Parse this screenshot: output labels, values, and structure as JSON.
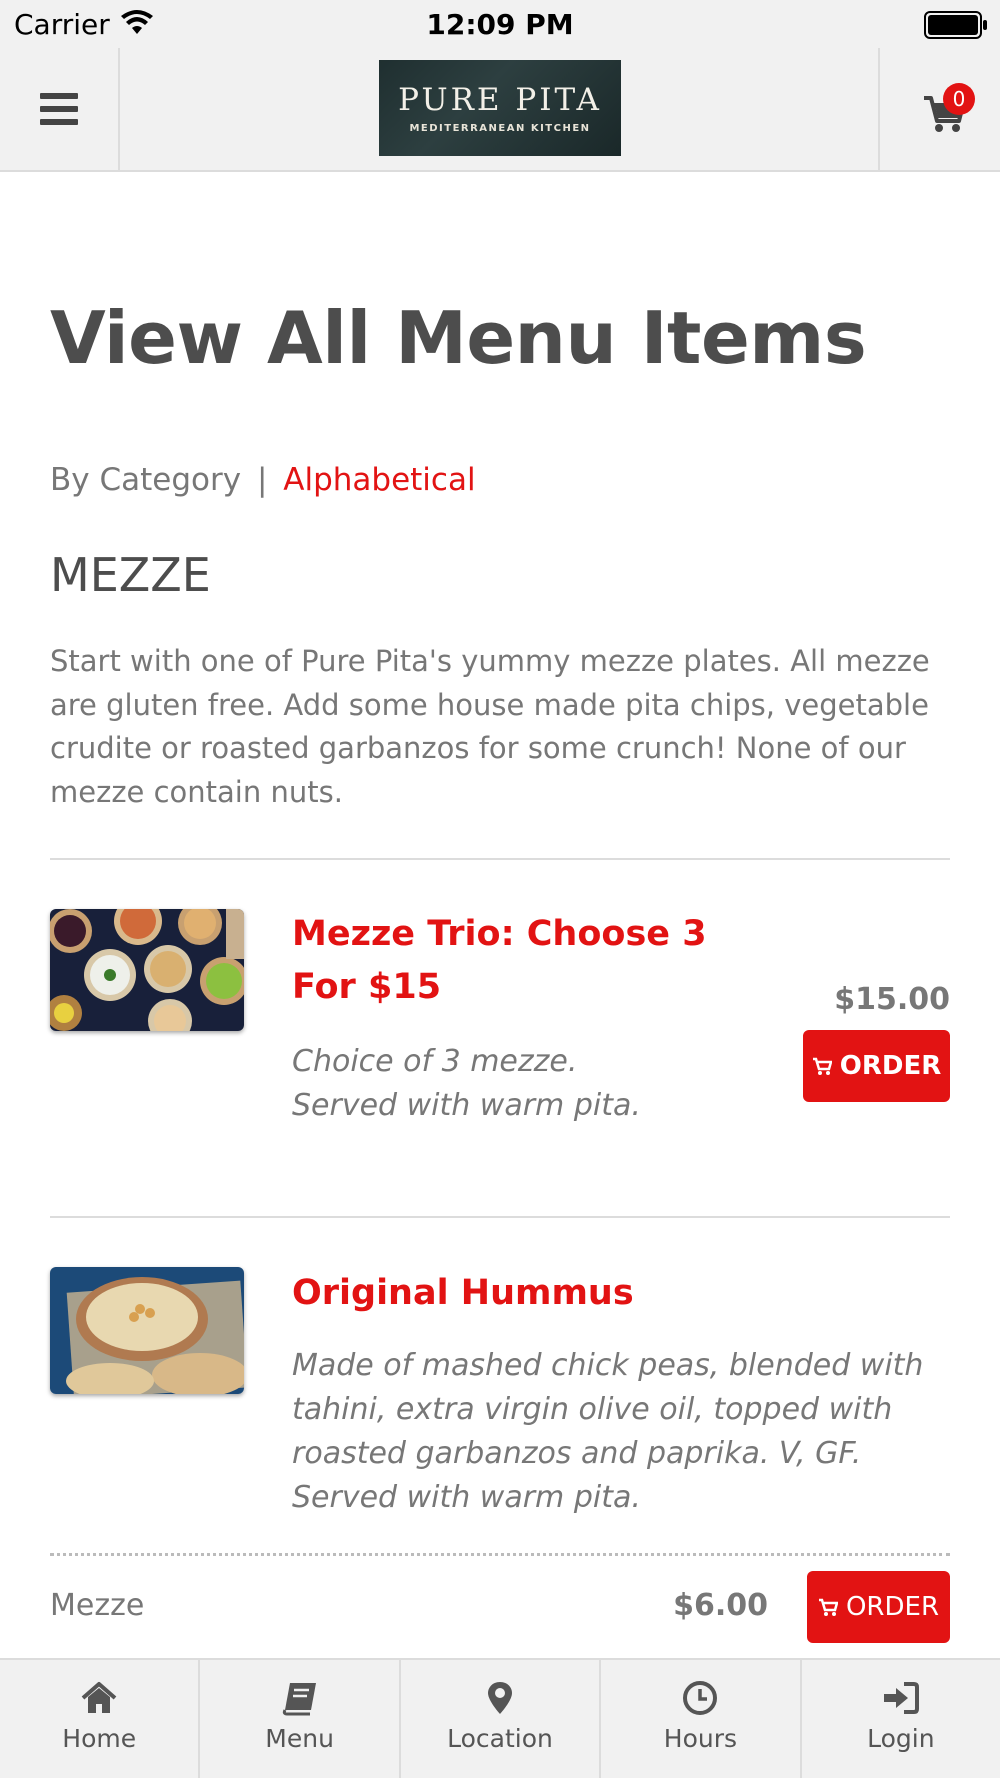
{
  "status_bar": {
    "carrier": "Carrier",
    "time": "12:09 PM"
  },
  "header": {
    "logo_title": "PURE PITA",
    "logo_subtitle": "MEDITERRANEAN KITCHEN",
    "cart_count": "0"
  },
  "page": {
    "title": "View All Menu Items",
    "view_by_category": "By Category",
    "view_separator": "|",
    "view_alphabetical": "Alphabetical"
  },
  "category": {
    "title": "MEZZE",
    "description": "Start with one of Pure Pita's yummy mezze plates. All mezze are gluten free. Add some house made pita chips, vegetable crudite or roasted garbanzos for some crunch! None of our mezze contain nuts."
  },
  "items": [
    {
      "name": "Mezze Trio: Choose 3 For $15",
      "description": "Choice of 3 mezze. Served with warm pita.",
      "price": "$15.00",
      "order_label": "ORDER"
    },
    {
      "name": "Original Hummus",
      "description": "Made of mashed chick peas, blended with tahini, extra virgin olive oil, topped with roasted garbanzos and paprika. V, GF. Served with warm pita.",
      "category": "Mezze",
      "price": "$6.00",
      "order_label": "ORDER"
    }
  ],
  "bottom_nav": [
    {
      "label": "Home",
      "icon": "home-icon"
    },
    {
      "label": "Menu",
      "icon": "book-icon"
    },
    {
      "label": "Location",
      "icon": "map-pin-icon"
    },
    {
      "label": "Hours",
      "icon": "clock-icon"
    },
    {
      "label": "Login",
      "icon": "sign-in-icon"
    }
  ],
  "colors": {
    "accent": "#e21313",
    "text": "#555555",
    "muted": "#777777",
    "bar": "#f1f1f1"
  }
}
